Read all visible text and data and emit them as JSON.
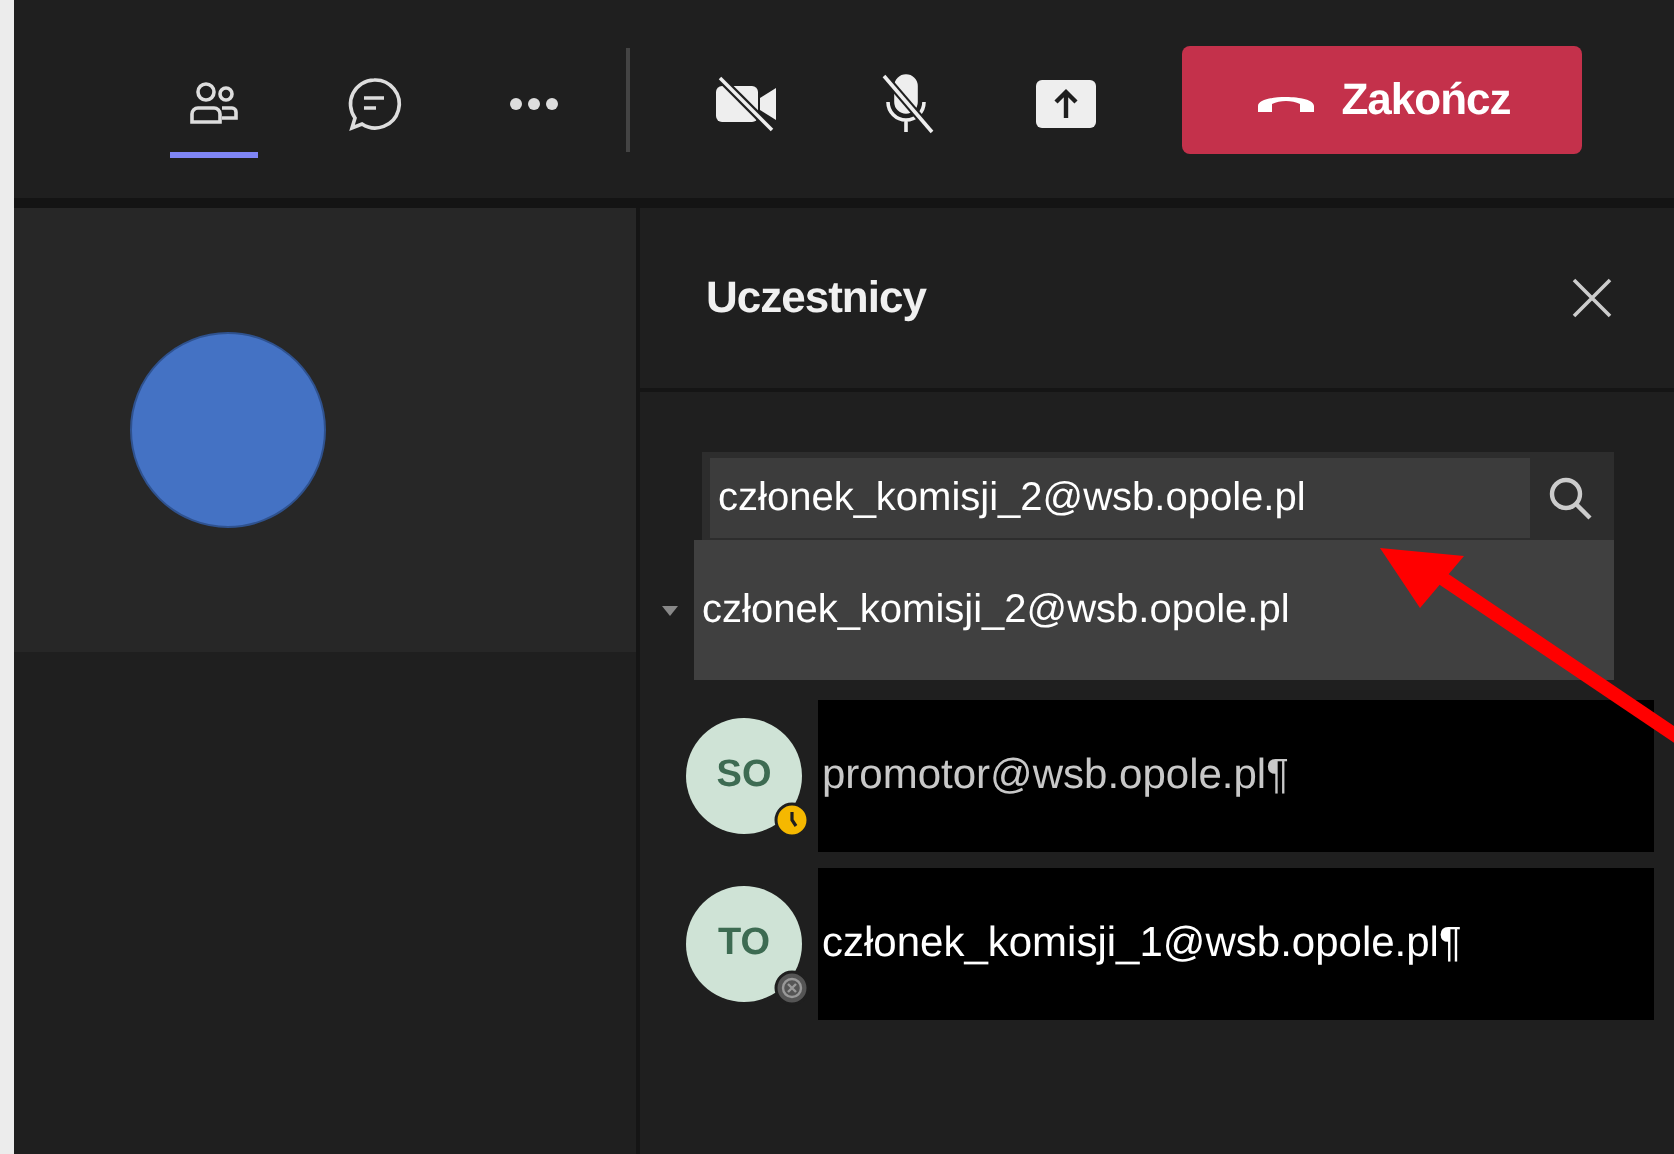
{
  "toolbar": {
    "items": [
      {
        "kind": "people",
        "selected": true
      },
      {
        "kind": "chat",
        "selected": false
      },
      {
        "kind": "more",
        "selected": false
      },
      {
        "kind": "camera-off",
        "selected": false
      },
      {
        "kind": "mic-off",
        "selected": false
      },
      {
        "kind": "share",
        "selected": false
      }
    ],
    "end_button": {
      "label": "Zakończ"
    }
  },
  "panel": {
    "title": "Uczestnicy",
    "search": {
      "value": "członek_komisji_2@wsb.opole.pl"
    },
    "suggestion": "członek_komisji_2@wsb.opole.pl",
    "participants": [
      {
        "initials": "SO",
        "name": "promotor@wsb.opole.pl¶",
        "kind": "away"
      },
      {
        "initials": "TO",
        "name": "członek_komisji_1@wsb.opole.pl¶",
        "kind": "offline"
      }
    ]
  }
}
